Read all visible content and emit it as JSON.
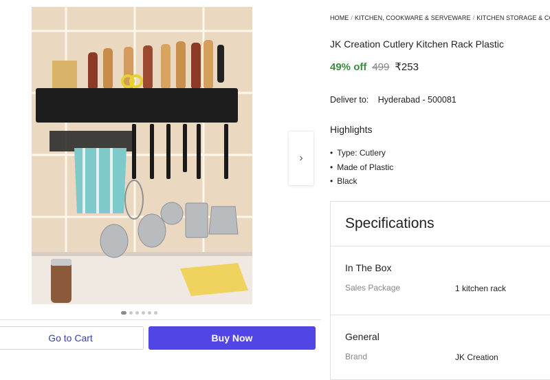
{
  "breadcrumb": [
    "HOME",
    "KITCHEN, COOKWARE & SERVEWARE",
    "KITCHEN STORAGE & CONT"
  ],
  "product": {
    "title": "JK Creation Cutlery Kitchen Rack Plastic",
    "discount": "49% off",
    "mrp": "499",
    "price": "₹253"
  },
  "delivery": {
    "label": "Deliver to:",
    "location": "Hyderabad - 500081"
  },
  "highlights": {
    "heading": "Highlights",
    "items": [
      "Type: Cutlery",
      "Made of Plastic",
      "Black"
    ]
  },
  "carousel": {
    "image_count": 6,
    "active_index": 0,
    "next_icon": "chevron-right-icon"
  },
  "actions": {
    "cart_label": "Go to Cart",
    "buy_label": "Buy Now"
  },
  "specifications": {
    "title": "Specifications",
    "sections": [
      {
        "heading": "In The Box",
        "rows": [
          {
            "key": "Sales Package",
            "value": "1 kitchen rack"
          }
        ]
      },
      {
        "heading": "General",
        "rows": [
          {
            "key": "Brand",
            "value": "JK Creation"
          }
        ]
      }
    ]
  },
  "colors": {
    "accent": "#5145e6",
    "discount": "#388e3c",
    "muted": "#878787"
  }
}
